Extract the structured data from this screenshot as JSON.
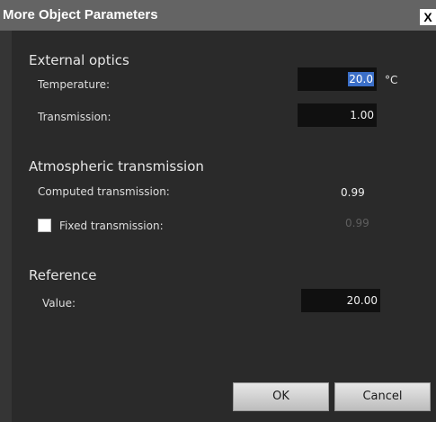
{
  "window": {
    "title": "More Object Parameters",
    "close_glyph": "X"
  },
  "external_optics": {
    "heading": "External optics",
    "temperature_label": "Temperature:",
    "temperature_value": "20.0",
    "temperature_unit": "°C",
    "transmission_label": "Transmission:",
    "transmission_value": "1.00"
  },
  "atmospheric": {
    "heading": "Atmospheric transmission",
    "computed_label": "Computed transmission:",
    "computed_value": "0.99",
    "fixed_label": "Fixed transmission:",
    "fixed_value": "0.99",
    "fixed_checked": false
  },
  "reference": {
    "heading": "Reference",
    "value_label": "Value:",
    "value": "20.00"
  },
  "buttons": {
    "ok": "OK",
    "cancel": "Cancel"
  },
  "colors": {
    "titlebar": "#646464",
    "background": "#2a2a2a",
    "field": "#101010",
    "selection": "#3b6fc8"
  }
}
